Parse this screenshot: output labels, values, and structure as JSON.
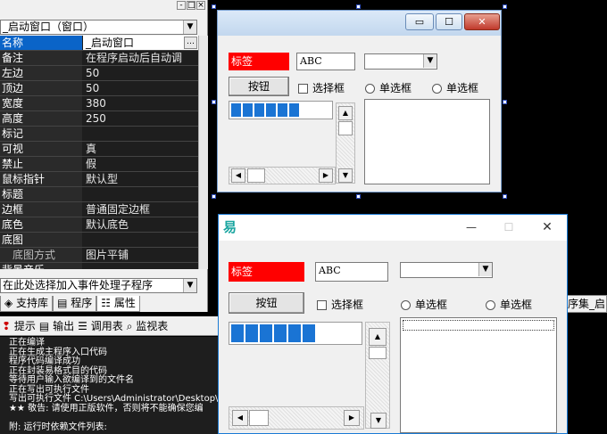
{
  "left_panel": {
    "min_btns": [
      "-",
      "□",
      "×"
    ],
    "object_combo": "_启动窗口（窗口）",
    "properties": [
      {
        "name": "名称",
        "value": "_启动窗口",
        "selected": true,
        "ellipsis": "…"
      },
      {
        "name": "备注",
        "value": "在程序启动后自动调"
      },
      {
        "name": "左边",
        "value": "50"
      },
      {
        "name": "顶边",
        "value": "50"
      },
      {
        "name": "宽度",
        "value": "380"
      },
      {
        "name": "高度",
        "value": "250"
      },
      {
        "name": "标记",
        "value": ""
      },
      {
        "name": "可视",
        "value": "真"
      },
      {
        "name": "禁止",
        "value": "假"
      },
      {
        "name": "鼠标指针",
        "value": "默认型"
      },
      {
        "name": "标题",
        "value": ""
      },
      {
        "name": "边框",
        "value": "普通固定边框"
      },
      {
        "name": "底色",
        "value": "默认底色"
      },
      {
        "name": "底图",
        "value": ""
      },
      {
        "name": "底图方式",
        "value": "图片平铺",
        "sub": true
      },
      {
        "name": "背景音乐",
        "value": ""
      }
    ],
    "event_combo": "在此处选择加入事件处理子程序",
    "tabs": [
      "支持库",
      "程序",
      "属性"
    ],
    "right_tab": "序集_启"
  },
  "output": {
    "toolbar": [
      "提示",
      "输出",
      "调用表",
      "监视表"
    ],
    "lines": [
      "正在编译",
      "正在生成主程序入口代码",
      "程序代码编译成功",
      "正在封装易格式目的代码",
      "等待用户输入欲编译到的文件名",
      "正在写出可执行文件",
      "写出可执行文件 C:\\Users\\Administrator\\Desktop\\",
      "★★ 敬告: 请使用正版软件，否则将不能确保您编",
      "",
      "附:  运行时依赖文件列表:"
    ]
  },
  "design_window": {
    "label": "标签",
    "edit": "ABC",
    "button": "按钮",
    "checkbox": "选择框",
    "radio1": "单选框",
    "radio2": "单选框",
    "progress_blocks": 6
  },
  "preview_window": {
    "label": "标签",
    "edit": "ABC",
    "button": "按钮",
    "checkbox": "选择框",
    "radio1": "单选框",
    "radio2": "单选框",
    "progress_blocks": 6,
    "controls": [
      "—",
      "☐",
      "✕"
    ]
  },
  "colors": {
    "label_bg": "#ff0000",
    "progress": "#1a74d4",
    "selection": "#0a64c8"
  }
}
